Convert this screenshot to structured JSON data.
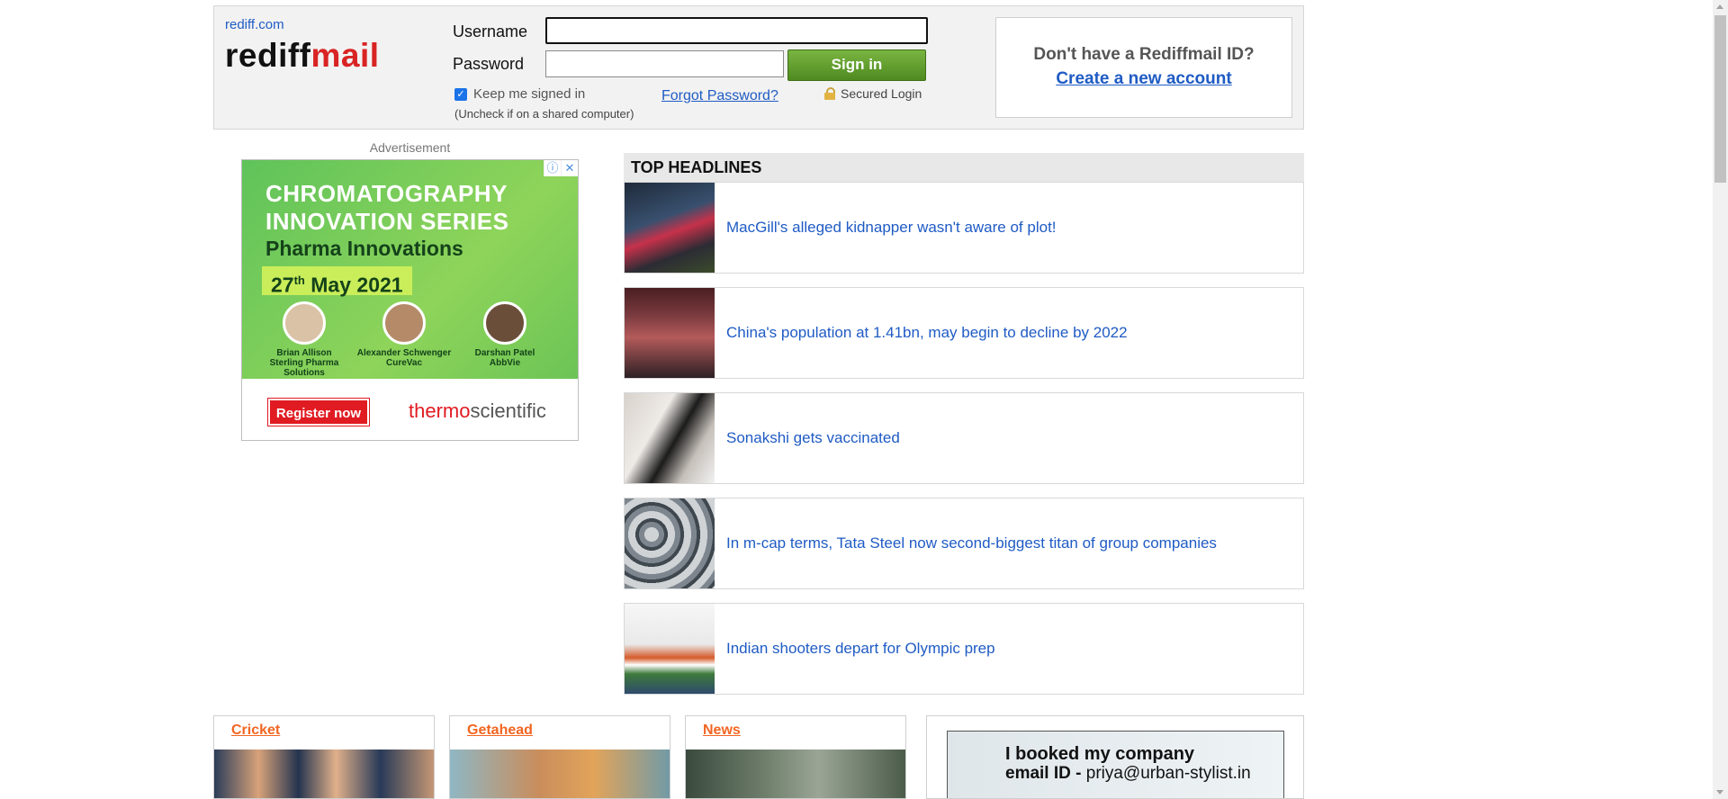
{
  "header": {
    "site_link": "rediff.com",
    "logo_part1": "rediff",
    "logo_part2": "mail",
    "username_label": "Username",
    "password_label": "Password",
    "username_value": "",
    "password_value": "",
    "signin_label": "Sign in",
    "keep_signed_in": "Keep me signed in",
    "keep_signed_in_checked": true,
    "uncheck_note": "(Uncheck if on a shared computer)",
    "forgot_password": "Forgot Password?",
    "secured_login": "Secured Login",
    "signup_question": "Don't have a Rediffmail ID?",
    "create_account": "Create a new account"
  },
  "ad": {
    "label": "Advertisement",
    "line1": "CHROMATOGRAPHY",
    "line2": "INNOVATION SERIES",
    "line3": "Pharma Innovations",
    "date_day": "27",
    "date_suffix": "th",
    "date_rest": " May 2021",
    "people": [
      {
        "name": "Brian Allison",
        "org": "Sterling Pharma Solutions"
      },
      {
        "name": "Alexander Schwenger",
        "org": "CureVac"
      },
      {
        "name": "Darshan Patel",
        "org": "AbbVie"
      }
    ],
    "register": "Register now",
    "brand_1": "thermo",
    "brand_2": "scientific"
  },
  "headlines": {
    "title": "TOP HEADLINES",
    "items": [
      {
        "title": "MacGill's alleged kidnapper wasn't aware of plot!"
      },
      {
        "title": "China's population at 1.41bn, may begin to decline by 2022"
      },
      {
        "title": "Sonakshi gets vaccinated"
      },
      {
        "title": "In m-cap terms, Tata Steel now second-biggest titan of group companies"
      },
      {
        "title": "Indian shooters depart for Olympic prep"
      }
    ]
  },
  "sections": [
    {
      "label": "Cricket"
    },
    {
      "label": "Getahead"
    },
    {
      "label": "News"
    }
  ],
  "promo": {
    "line1": "I booked my company",
    "line2_bold": "email ID - ",
    "line2_rest": "priya@urban-stylist.in"
  },
  "colors": {
    "link_blue": "#1f5bc4",
    "logo_red": "#d92424",
    "signin_green": "#5a9a2a",
    "section_orange": "#f26522"
  }
}
